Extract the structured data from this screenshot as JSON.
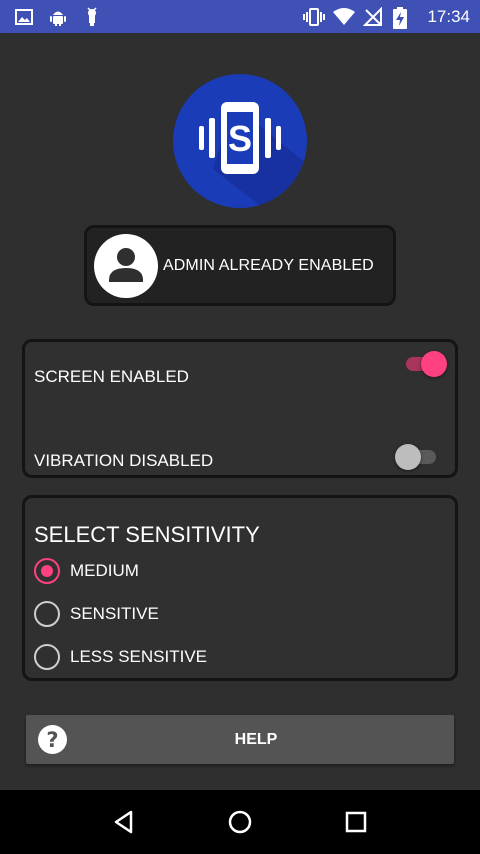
{
  "status_bar": {
    "time": "17:34",
    "left_icons": [
      "image-icon",
      "android-icon",
      "android-debug-icon"
    ],
    "right_icons": [
      "vibrate-icon",
      "wifi-icon",
      "no-signal-icon",
      "battery-charging-icon"
    ]
  },
  "logo": {
    "letter": "S"
  },
  "admin_button": {
    "label": "ADMIN ALREADY ENABLED"
  },
  "toggles": [
    {
      "label": "SCREEN ENABLED",
      "on": true
    },
    {
      "label": "VIBRATION DISABLED",
      "on": false
    }
  ],
  "sensitivity": {
    "title": "SELECT SENSITIVITY",
    "options": [
      {
        "label": "MEDIUM",
        "selected": true
      },
      {
        "label": "SENSITIVE",
        "selected": false
      },
      {
        "label": "LESS SENSITIVE",
        "selected": false
      }
    ]
  },
  "help_button": {
    "label": "HELP",
    "icon": "?"
  },
  "colors": {
    "status_bar": "#3f51b5",
    "accent": "#ff4081",
    "background": "#2f2f2f",
    "logo_bg": "#1a3cb8"
  },
  "nav_bar": {
    "buttons": [
      "back-icon",
      "home-icon",
      "recents-icon"
    ]
  }
}
